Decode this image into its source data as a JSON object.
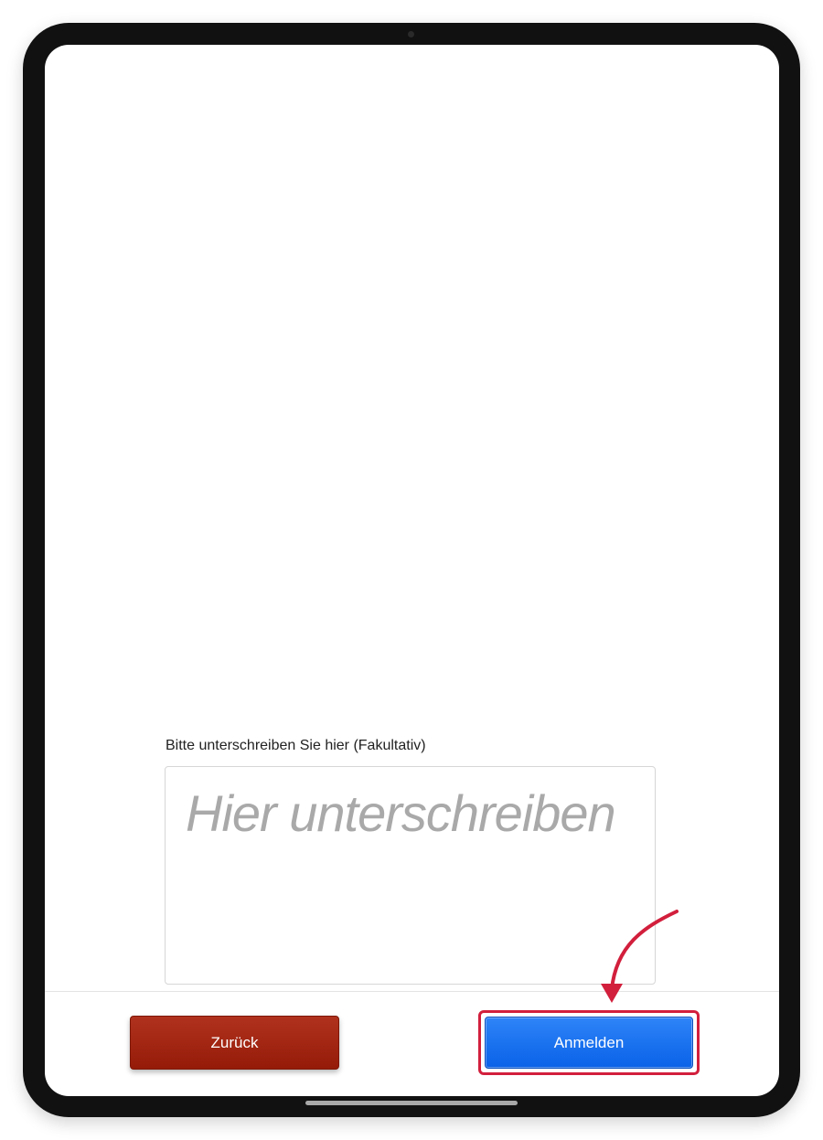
{
  "signature": {
    "label": "Bitte unterschreiben Sie hier (Fakultativ)",
    "placeholder": "Hier unterschreiben"
  },
  "footer": {
    "back_label": "Zurück",
    "login_label": "Anmelden"
  },
  "colors": {
    "back_button": "#a02410",
    "login_button": "#1a73f0",
    "annotation_red": "#d21f3c",
    "device_frame": "#111111"
  },
  "icons": {
    "annotation_arrow": "curved-arrow-down-icon"
  }
}
